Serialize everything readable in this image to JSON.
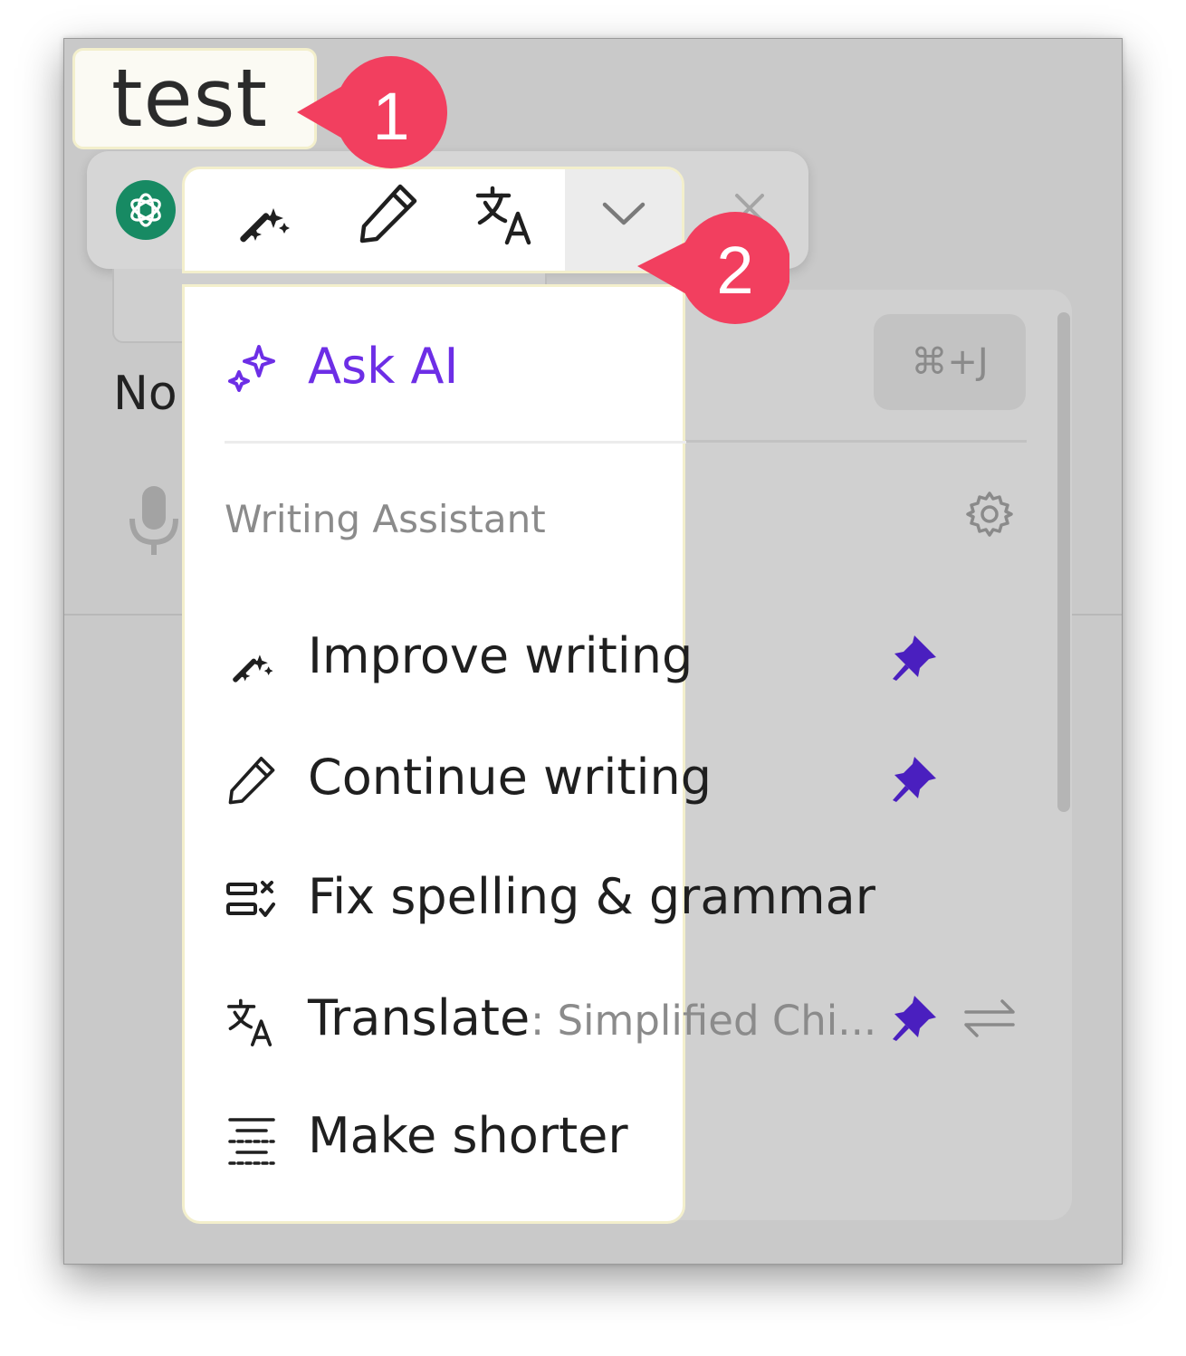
{
  "selected_text": "test",
  "annotations": [
    "1",
    "2"
  ],
  "toolbar": {
    "tools": [
      "improve-writing",
      "continue-writing",
      "translate",
      "more"
    ]
  },
  "background": {
    "note_partial": "No",
    "shortcut": "⌘+J"
  },
  "menu": {
    "ask_ai": "Ask AI",
    "section_title": "Writing Assistant",
    "items": [
      {
        "label": "Improve writing",
        "icon": "magic-wand-icon",
        "pinned": true
      },
      {
        "label": "Continue writing",
        "icon": "pencil-icon",
        "pinned": true
      },
      {
        "label": "Fix spelling & grammar",
        "icon": "spellcheck-icon",
        "pinned": false
      },
      {
        "label": "Translate",
        "suffix": ": Simplified Chi...",
        "icon": "translate-icon",
        "pinned": true
      },
      {
        "label": "Make shorter",
        "icon": "shorten-text-icon",
        "pinned": false
      }
    ]
  },
  "colors": {
    "accent_purple": "#6d2ee6",
    "pin_purple": "#4a1fbf",
    "badge_red": "#f23f5f"
  }
}
